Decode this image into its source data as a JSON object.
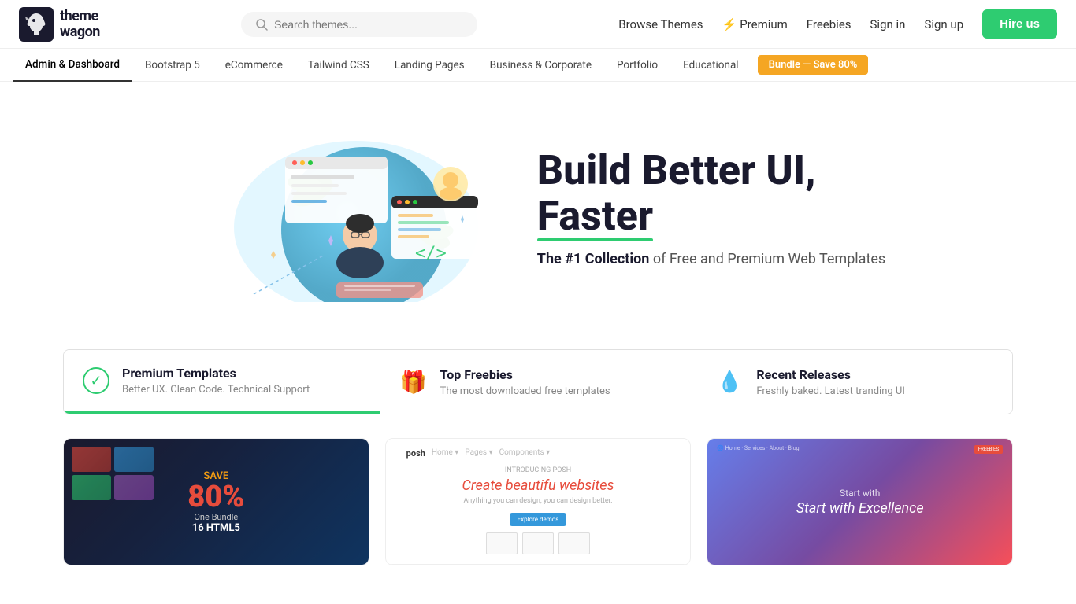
{
  "header": {
    "logo_top": "theme",
    "logo_bottom": "wagon",
    "search_placeholder": "Search themes...",
    "nav_links": [
      {
        "id": "browse-themes",
        "label": "Browse Themes"
      },
      {
        "id": "premium",
        "label": "Premium",
        "emoji": "⚡"
      },
      {
        "id": "freebies",
        "label": "Freebies"
      },
      {
        "id": "sign-in",
        "label": "Sign in"
      },
      {
        "id": "sign-up",
        "label": "Sign up"
      }
    ],
    "hire_btn_label": "Hire us"
  },
  "category_nav": {
    "items": [
      {
        "id": "admin",
        "label": "Admin & Dashboard",
        "active": true
      },
      {
        "id": "bootstrap5",
        "label": "Bootstrap 5"
      },
      {
        "id": "ecommerce",
        "label": "eCommerce"
      },
      {
        "id": "tailwind",
        "label": "Tailwind CSS"
      },
      {
        "id": "landing",
        "label": "Landing Pages"
      },
      {
        "id": "business",
        "label": "Business & Corporate"
      },
      {
        "id": "portfolio",
        "label": "Portfolio"
      },
      {
        "id": "educational",
        "label": "Educational"
      }
    ],
    "bundle_label": "Bundle — Save 80%"
  },
  "hero": {
    "title_line1": "Build Better UI,",
    "title_line2": "Faster",
    "subtitle_strong": "The #1 Collection",
    "subtitle_rest": " of Free and Premium Web Templates"
  },
  "feature_tabs": [
    {
      "id": "premium",
      "icon": "checkmark",
      "title": "Premium Templates",
      "subtitle": "Better UX. Clean Code. Technical Support",
      "active": true
    },
    {
      "id": "freebies",
      "icon": "gift",
      "title": "Top Freebies",
      "subtitle": "The most downloaded free templates"
    },
    {
      "id": "recent",
      "icon": "drop",
      "title": "Recent Releases",
      "subtitle": "Freshly baked. Latest tranding UI"
    }
  ],
  "cards": [
    {
      "id": "bundle",
      "save_label": "SAVE",
      "percent": "80%",
      "line1": "One Bundle",
      "line2": "16 HTML5"
    },
    {
      "id": "posh",
      "brand": "posh",
      "nav_items": [
        "Home",
        "Pages",
        "Components"
      ],
      "intro_label": "INTRODUCING POSH",
      "title_plain": "Create ",
      "title_colored": "beautifu",
      "title_end": " websites",
      "subtitle": "Anything you can design, you can design better."
    },
    {
      "id": "excellence",
      "nav_items": [
        "Home",
        "Services",
        "About",
        "Blog"
      ],
      "badge": "FREEBIES",
      "start_text": "Start with",
      "bold_text": "Excellence"
    }
  ]
}
